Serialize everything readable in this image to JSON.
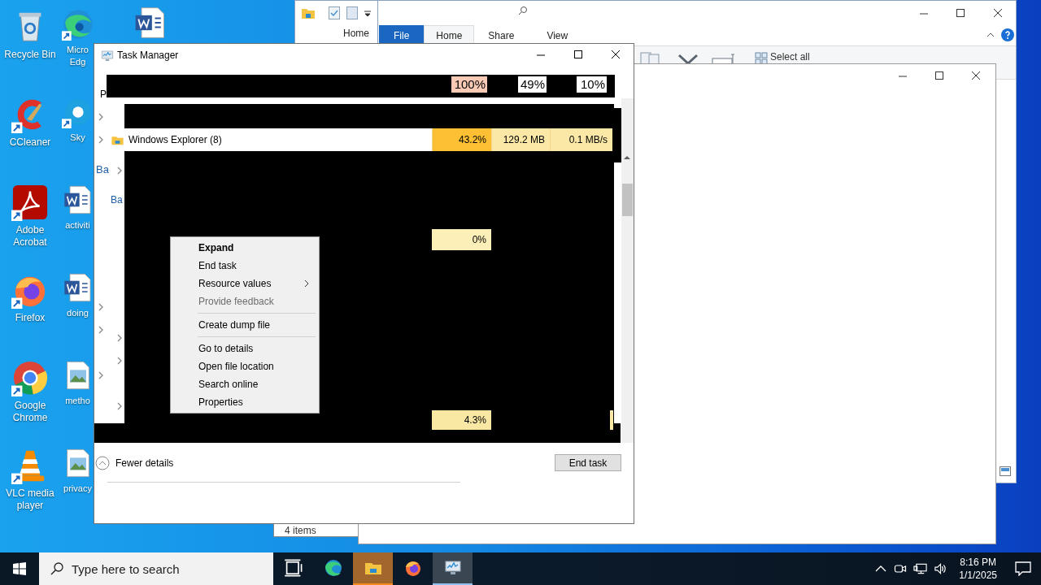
{
  "desktop": {
    "column_1": [
      {
        "label": "Recycle Bin",
        "kind": "recycle",
        "shortcut": false
      },
      {
        "label": "CCleaner",
        "kind": "ccleaner",
        "shortcut": true
      },
      {
        "label": "Adobe Acrobat",
        "kind": "acrobat",
        "shortcut": true
      },
      {
        "label": "Firefox",
        "kind": "firefox",
        "shortcut": true
      },
      {
        "label": "Google Chrome",
        "kind": "chrome",
        "shortcut": true
      },
      {
        "label": "VLC media player",
        "kind": "vlc",
        "shortcut": true
      }
    ],
    "column_2": [
      {
        "label": "Micro Edg",
        "kind": "edge",
        "shortcut": true
      },
      {
        "label": "Sky",
        "kind": "skype",
        "shortcut": true
      },
      {
        "label": "activiti",
        "kind": "word",
        "shortcut": false
      },
      {
        "label": "doing",
        "kind": "word",
        "shortcut": false
      },
      {
        "label": "metho",
        "kind": "image",
        "shortcut": false
      },
      {
        "label": "privacy",
        "kind": "image",
        "shortcut": false
      }
    ],
    "column_3": [
      {
        "kind": "word",
        "shortcut": false
      }
    ]
  },
  "explorer": {
    "ghost_tab": "Home",
    "tabs": [
      {
        "label": "File",
        "kind": "file",
        "selected": false
      },
      {
        "label": "Home",
        "kind": "tab",
        "selected": true
      },
      {
        "label": "Share",
        "kind": "tab",
        "selected": false
      },
      {
        "label": "View",
        "kind": "tab",
        "selected": false
      }
    ],
    "ribbon_command": "Select all"
  },
  "status_window": {
    "status": "4 items"
  },
  "task_manager": {
    "title": "Task Manager",
    "tab_fragment": "P",
    "group_fragments": [
      "Ba",
      "Ba"
    ],
    "header_cells": [
      {
        "text": "100%",
        "color": "#f9cbb6"
      },
      {
        "text": "49%",
        "color": "#ffffff"
      },
      {
        "text": "10%",
        "color": "#ffffff"
      }
    ],
    "process": {
      "name": "Windows Explorer (8)",
      "cells": [
        {
          "text": "43.2%",
          "color": "#fdc034"
        },
        {
          "text": "129.2 MB",
          "color": "#fbe8a6"
        },
        {
          "text": "0.1 MB/s",
          "color": "#fbe8a6"
        }
      ]
    },
    "loose_cells": [
      {
        "text": "0%",
        "color": "#fcefb8"
      },
      {
        "text": "4.3%",
        "color": "#f9e8a4"
      }
    ],
    "footer": {
      "toggle": "Fewer details",
      "button": "End task"
    }
  },
  "context_menu": {
    "groups": [
      [
        {
          "label": "Expand",
          "default": true,
          "disabled": false,
          "submenu": false
        },
        {
          "label": "End task",
          "default": false,
          "disabled": false,
          "submenu": false
        },
        {
          "label": "Resource values",
          "default": false,
          "disabled": false,
          "submenu": true
        },
        {
          "label": "Provide feedback",
          "default": false,
          "disabled": true,
          "submenu": false
        }
      ],
      [
        {
          "label": "Create dump file",
          "default": false,
          "disabled": false,
          "submenu": false
        }
      ],
      [
        {
          "label": "Go to details",
          "default": false,
          "disabled": false,
          "submenu": false
        },
        {
          "label": "Open file location",
          "default": false,
          "disabled": false,
          "submenu": false
        },
        {
          "label": "Search online",
          "default": false,
          "disabled": false,
          "submenu": false
        },
        {
          "label": "Properties",
          "default": false,
          "disabled": false,
          "submenu": false
        }
      ]
    ]
  },
  "taskbar": {
    "search": {
      "placeholder": "Type here to search"
    },
    "apps": [
      {
        "kind": "edge",
        "selected": false,
        "flashing": false
      },
      {
        "kind": "explorer",
        "selected": false,
        "flashing": true
      },
      {
        "kind": "firefox",
        "selected": false,
        "flashing": false
      },
      {
        "kind": "task_manager",
        "selected": true,
        "flashing": false
      }
    ],
    "time": "8:16 PM",
    "date": "1/1/2025"
  }
}
